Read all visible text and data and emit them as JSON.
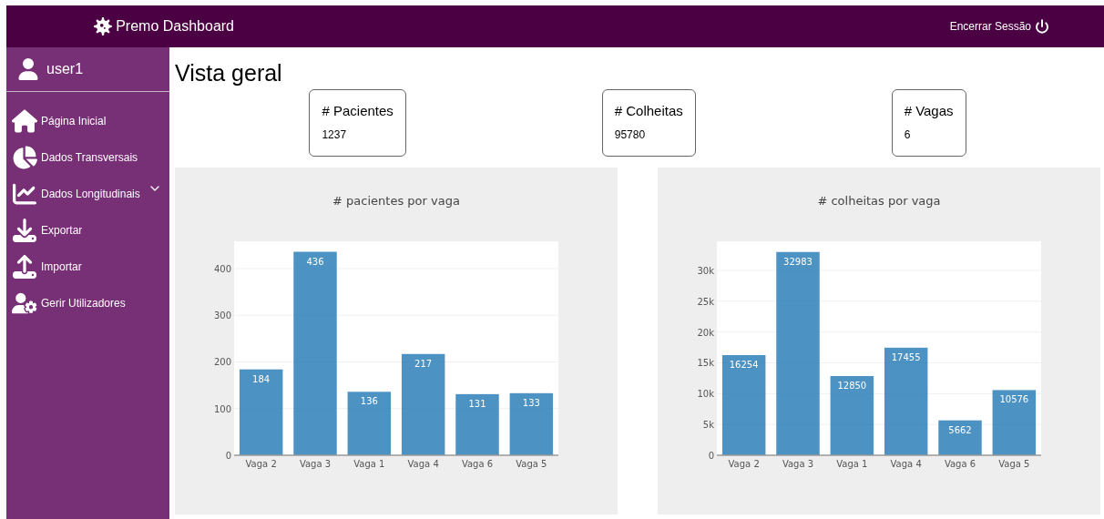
{
  "header": {
    "title": "Premo Dashboard",
    "logout": "Encerrar Sessão"
  },
  "sidebar": {
    "user": "user1",
    "items": [
      {
        "label": "Página Inicial",
        "kind": "link"
      },
      {
        "label": "Dados Transversais",
        "kind": "link"
      },
      {
        "label": "Dados Longitudinais",
        "kind": "dropdown",
        "expanded": false
      },
      {
        "label": "Exportar",
        "kind": "link"
      },
      {
        "label": "Importar",
        "kind": "link"
      },
      {
        "label": "Gerir Utilizadores",
        "kind": "link"
      }
    ]
  },
  "page_title": "Vista geral",
  "stats": [
    {
      "label": "# Pacientes",
      "value": "1237"
    },
    {
      "label": "# Colheitas",
      "value": "95780"
    },
    {
      "label": "# Vagas",
      "value": "6"
    }
  ],
  "charts": [
    {
      "chart_data": {
        "type": "bar",
        "title": "# pacientes por vaga",
        "categories": [
          "Vaga 2",
          "Vaga 3",
          "Vaga 1",
          "Vaga 4",
          "Vaga 6",
          "Vaga 5"
        ],
        "series": [
          {
            "color": "#1f77b4",
            "values": [
              184,
              436,
              136,
              217,
              131,
              133
            ]
          }
        ],
        "grid": true,
        "ylim": [
          0,
          458.5
        ],
        "yticks": [
          0,
          100,
          200,
          300,
          400
        ],
        "data_labels": true
      }
    },
    {
      "chart_data": {
        "type": "bar",
        "title": "# colheitas por vaga",
        "categories": [
          "Vaga 2",
          "Vaga 3",
          "Vaga 1",
          "Vaga 4",
          "Vaga 6",
          "Vaga 5"
        ],
        "series": [
          {
            "color": "#1f77b4",
            "values": [
              16254,
              32983,
              12850,
              17455,
              5662,
              10576
            ]
          }
        ],
        "grid": true,
        "ylim": [
          0,
          34720
        ],
        "yticks": [
          {
            "value": 0,
            "label": "0"
          },
          {
            "value": 5000,
            "label": "5k"
          },
          {
            "value": 10000,
            "label": "10k"
          },
          {
            "value": 15000,
            "label": "15k"
          },
          {
            "value": 20000,
            "label": "20k"
          },
          {
            "value": 25000,
            "label": "25k"
          },
          {
            "value": 30000,
            "label": "30k"
          }
        ],
        "data_labels": true
      }
    }
  ]
}
